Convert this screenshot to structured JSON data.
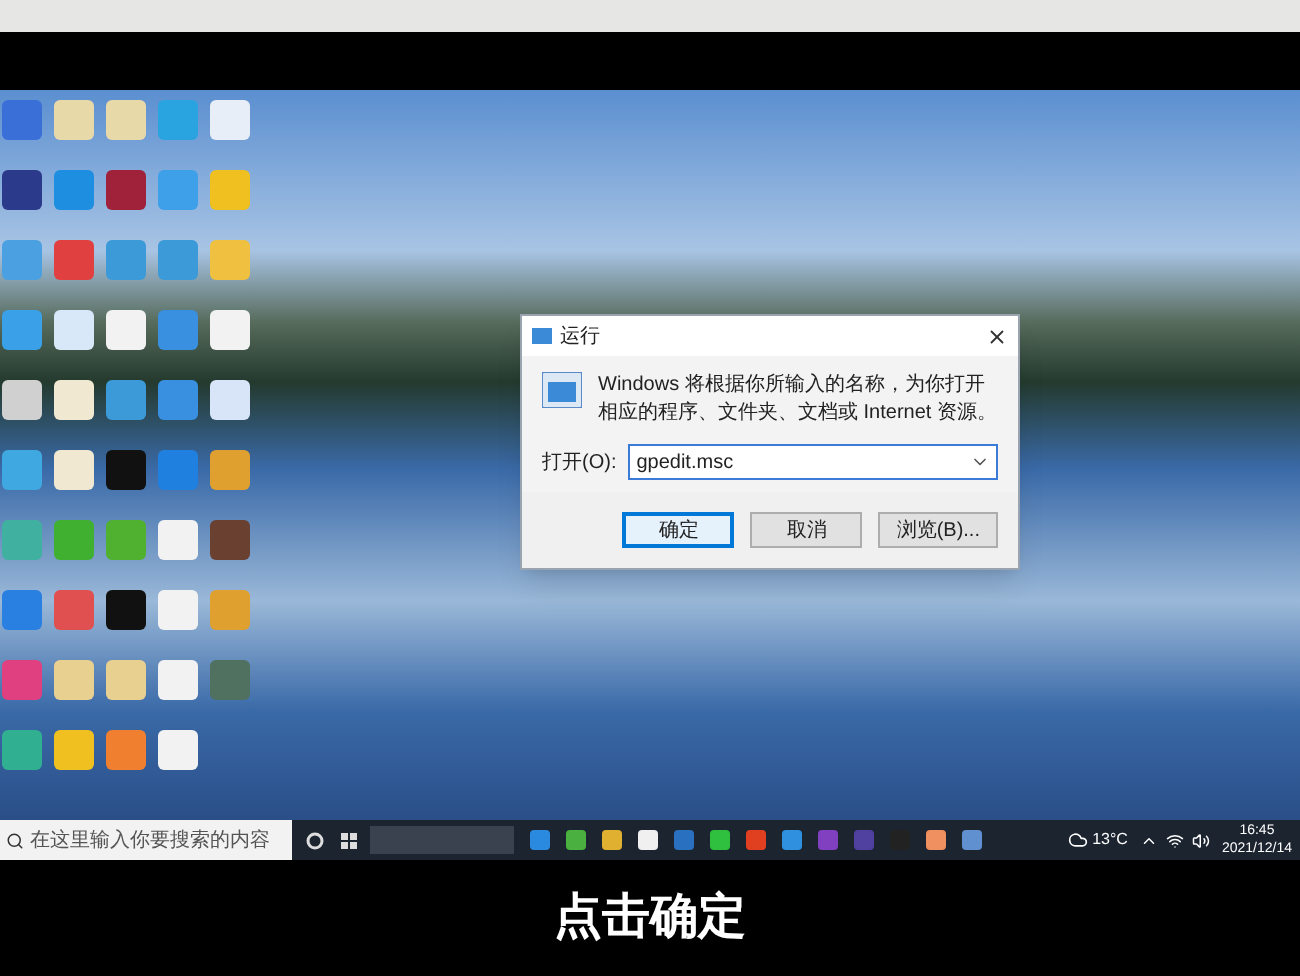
{
  "desktop_icons": [
    {
      "color": "#3a6fd8"
    },
    {
      "color": "#e8d9a8"
    },
    {
      "color": "#e8d9a8"
    },
    {
      "color": "#2aa4e0"
    },
    {
      "color": "#e8eef8"
    },
    {
      "color": "#2b3a8a"
    },
    {
      "color": "#1e8fe0"
    },
    {
      "color": "#a0213a"
    },
    {
      "color": "#3da0e8"
    },
    {
      "color": "#f0c020"
    },
    {
      "color": "#4aa0e0"
    },
    {
      "color": "#e04040"
    },
    {
      "color": "#3c9ad8"
    },
    {
      "color": "#3c9ad8"
    },
    {
      "color": "#f0c040"
    },
    {
      "color": "#3aa0e8"
    },
    {
      "color": "#d8e8f8"
    },
    {
      "color": "#f2f2f2"
    },
    {
      "color": "#3a90e0"
    },
    {
      "color": "#f2f2f2"
    },
    {
      "color": "#d0d0d0"
    },
    {
      "color": "#f0e8d0"
    },
    {
      "color": "#3c9ad8"
    },
    {
      "color": "#3a90e0"
    },
    {
      "color": "#d8e4f8"
    },
    {
      "color": "#40a8e0"
    },
    {
      "color": "#f0e8d0"
    },
    {
      "color": "#111111"
    },
    {
      "color": "#2080e0"
    },
    {
      "color": "#e0a030"
    },
    {
      "color": "#40b0a0"
    },
    {
      "color": "#40b030"
    },
    {
      "color": "#50b030"
    },
    {
      "color": "#f2f2f2"
    },
    {
      "color": "#6a4030"
    },
    {
      "color": "#2a80e0"
    },
    {
      "color": "#e05050"
    },
    {
      "color": "#111111"
    },
    {
      "color": "#f2f2f2"
    },
    {
      "color": "#e0a030"
    },
    {
      "color": "#e04080"
    },
    {
      "color": "#e8d090"
    },
    {
      "color": "#e8d090"
    },
    {
      "color": "#f2f2f2"
    },
    {
      "color": "#507060"
    },
    {
      "color": "#30b090"
    },
    {
      "color": "#f0c020"
    },
    {
      "color": "#f08030"
    },
    {
      "color": "#f2f2f2"
    }
  ],
  "run_dialog": {
    "title": "运行",
    "description": "Windows 将根据你所输入的名称，为你打开相应的程序、文件夹、文档或 Internet 资源。",
    "open_label": "打开(O):",
    "command": "gpedit.msc",
    "buttons": [
      {
        "label": "确定",
        "focused": true
      },
      {
        "label": "取消",
        "focused": false
      },
      {
        "label": "浏览(B)...",
        "focused": false
      }
    ]
  },
  "taskbar": {
    "search_placeholder": "在这里输入你要搜索的内容",
    "apps": [
      {
        "color": "#2a8ae0"
      },
      {
        "color": "#4ab040"
      },
      {
        "color": "#e0b030"
      },
      {
        "color": "#f0f0f0"
      },
      {
        "color": "#2a70c0"
      },
      {
        "color": "#30c040"
      },
      {
        "color": "#e04020"
      },
      {
        "color": "#3090e0"
      },
      {
        "color": "#8040c0"
      },
      {
        "color": "#5040a0"
      },
      {
        "color": "#222222"
      },
      {
        "color": "#f09060"
      },
      {
        "color": "#6090d0"
      }
    ],
    "temperature": "13°C",
    "time": "16:45",
    "date": "2021/12/14"
  },
  "caption": "点击确定"
}
